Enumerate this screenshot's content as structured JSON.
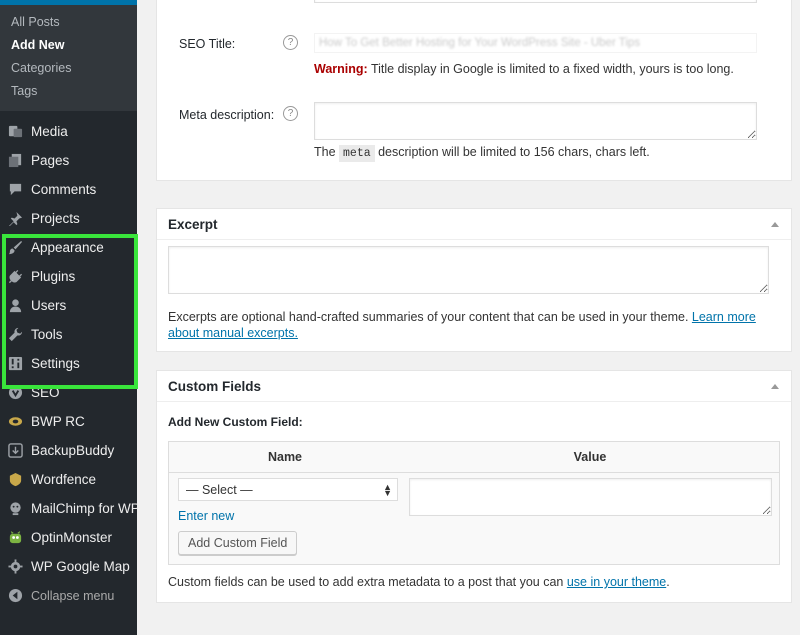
{
  "sidebar": {
    "submenu": [
      {
        "label": "All Posts",
        "current": false
      },
      {
        "label": "Add New",
        "current": true
      },
      {
        "label": "Categories",
        "current": false
      },
      {
        "label": "Tags",
        "current": false
      }
    ],
    "items": [
      {
        "label": "Media",
        "icon": "media-icon"
      },
      {
        "label": "Pages",
        "icon": "pages-icon"
      },
      {
        "label": "Comments",
        "icon": "comments-icon"
      },
      {
        "label": "Projects",
        "icon": "pin-icon"
      },
      {
        "label": "Appearance",
        "icon": "paintbrush-icon"
      },
      {
        "label": "Plugins",
        "icon": "plug-icon"
      },
      {
        "label": "Users",
        "icon": "user-icon"
      },
      {
        "label": "Tools",
        "icon": "wrench-icon"
      },
      {
        "label": "Settings",
        "icon": "settings-icon"
      },
      {
        "label": "SEO",
        "icon": "seo-icon"
      },
      {
        "label": "BWP RC",
        "icon": "bwp-icon"
      },
      {
        "label": "BackupBuddy",
        "icon": "backup-icon"
      },
      {
        "label": "Wordfence",
        "icon": "wordfence-icon"
      },
      {
        "label": "MailChimp for WP",
        "icon": "mailchimp-icon"
      },
      {
        "label": "OptinMonster",
        "icon": "optinmonster-icon"
      },
      {
        "label": "WP Google Map",
        "icon": "gear-icon"
      }
    ],
    "collapse_label": "Collapse menu",
    "highlight_color": "#39e53b"
  },
  "seo": {
    "title_label": "SEO Title:",
    "title_value": "How To Get Better Hosting for Your WordPress Site - Uber Tips",
    "warning_prefix": "Warning:",
    "warning_text": " Title display in Google is limited to a fixed width, yours is too long.",
    "meta_label": "Meta description:",
    "meta_note_before": "The ",
    "meta_code": "meta",
    "meta_note_after": " description will be limited to 156 chars, chars left."
  },
  "excerpt": {
    "title": "Excerpt",
    "help_text": "Excerpts are optional hand-crafted summaries of your content that can be used in your theme. ",
    "link_text": "Learn more about manual excerpts."
  },
  "custom_fields": {
    "title": "Custom Fields",
    "add_new_label": "Add New Custom Field:",
    "col_name": "Name",
    "col_value": "Value",
    "select_value": "— Select —",
    "enter_new": "Enter new",
    "add_button": "Add Custom Field",
    "footer_text": "Custom fields can be used to add extra metadata to a post that you can ",
    "footer_link": "use in your theme",
    "footer_end": "."
  }
}
